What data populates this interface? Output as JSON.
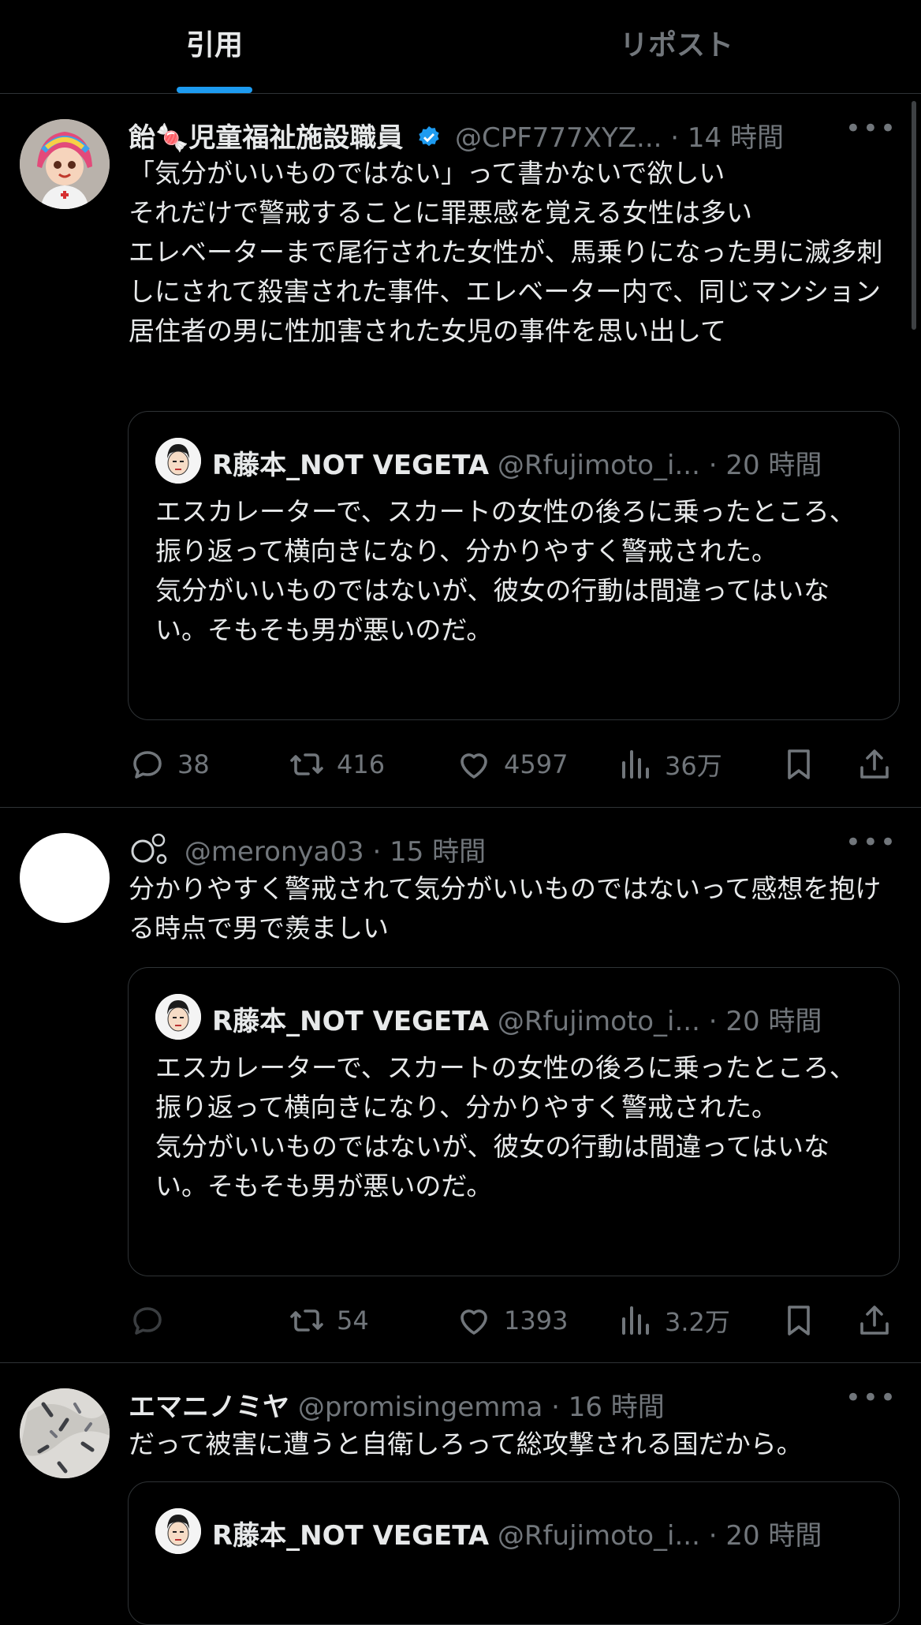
{
  "tabs": [
    {
      "label": "引用",
      "active": true
    },
    {
      "label": "リポスト",
      "active": false
    }
  ],
  "posts": [
    {
      "name": "飴🍬児童福祉施設職員",
      "verified": true,
      "handle": "@CPF777XYZ...",
      "time": "· 14 時間",
      "text": "「気分がいいものではない」って書かないで欲しい\nそれだけで警戒することに罪悪感を覚える女性は多い\nエレベーターまで尾行された女性が、馬乗りになった男に滅多刺しにされて殺害された事件、エレベーター内で、同じマンション居住者の男に性加害された女児の事件を思い出して",
      "quote": {
        "name": "R藤本_NOT VEGETA",
        "handle": "@Rfujimoto_i...",
        "time": "· 20 時間",
        "text": "エスカレーターで、スカートの女性の後ろに乗ったところ、振り返って横向きになり、分かりやすく警戒された。\n気分がいいものではないが、彼女の行動は間違ってはいない。そもそも男が悪いのだ。"
      },
      "replies": "38",
      "reposts": "416",
      "likes": "4597",
      "views": "36万"
    },
    {
      "name": "",
      "handle": "@meronya03",
      "time": "· 15 時間",
      "text": "分かりやすく警戒されて気分がいいものではないって感想を抱ける時点で男で羨ましい",
      "quote": {
        "name": "R藤本_NOT VEGETA",
        "handle": "@Rfujimoto_i...",
        "time": "· 20 時間",
        "text": "エスカレーターで、スカートの女性の後ろに乗ったところ、振り返って横向きになり、分かりやすく警戒された。\n気分がいいものではないが、彼女の行動は間違ってはいない。そもそも男が悪いのだ。"
      },
      "replies": "",
      "reposts": "54",
      "likes": "1393",
      "views": "3.2万"
    },
    {
      "name": "エマニノミヤ",
      "handle": "@promisingemma",
      "time": "· 16 時間",
      "text": "だって被害に遭うと自衛しろって総攻撃される国だから。",
      "quote": {
        "name": "R藤本_NOT VEGETA",
        "handle": "@Rfujimoto_i...",
        "time": "· 20 時間"
      }
    }
  ],
  "colors": {
    "background": "#000000",
    "text": "#e7e9ea",
    "muted": "#71767b",
    "accent": "#1d9bf0",
    "border": "#2f3336"
  },
  "icons": [
    "reply-icon",
    "repost-icon",
    "like-icon",
    "views-icon",
    "bookmark-icon",
    "share-icon",
    "verified-badge-icon",
    "more-icon"
  ]
}
